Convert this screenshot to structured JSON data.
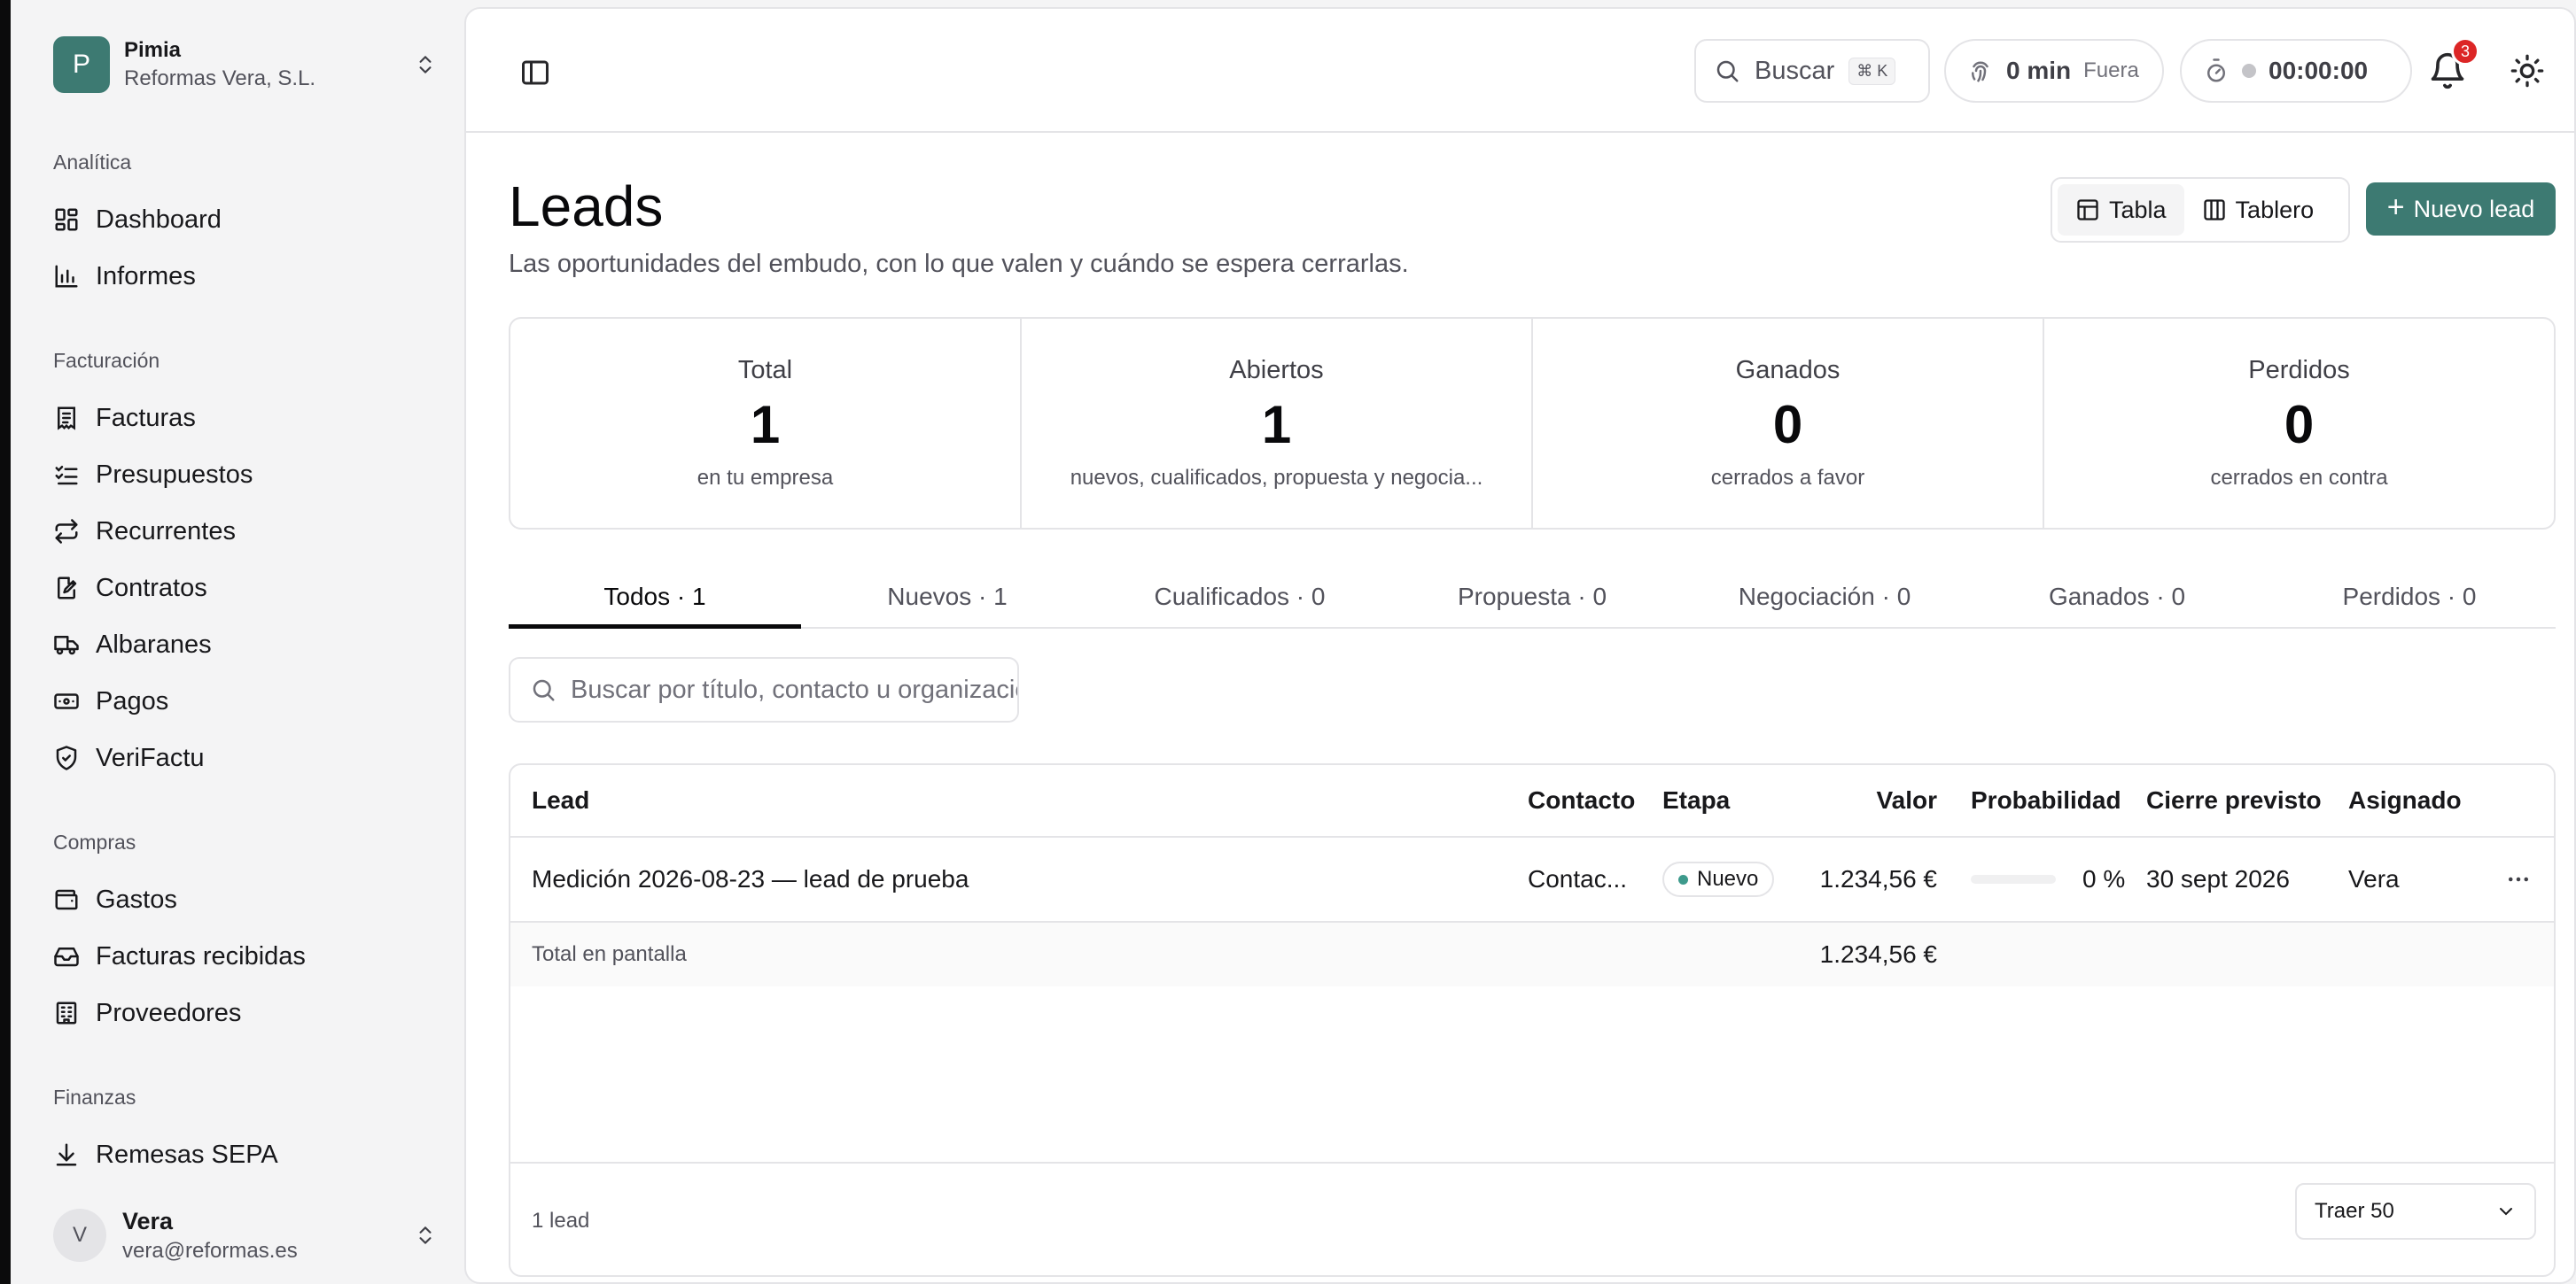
{
  "org": {
    "initial": "P",
    "name": "Pimia",
    "company": "Reformas Vera, S.L."
  },
  "sidebar": {
    "groups": [
      {
        "title": "Analítica",
        "items": [
          {
            "label": "Dashboard",
            "icon": "dashboard-icon"
          },
          {
            "label": "Informes",
            "icon": "bar-chart-icon"
          }
        ]
      },
      {
        "title": "Facturación",
        "items": [
          {
            "label": "Facturas",
            "icon": "invoice-icon"
          },
          {
            "label": "Presupuestos",
            "icon": "checklist-icon"
          },
          {
            "label": "Recurrentes",
            "icon": "repeat-icon"
          },
          {
            "label": "Contratos",
            "icon": "contract-edit-icon"
          },
          {
            "label": "Albaranes",
            "icon": "truck-icon"
          },
          {
            "label": "Pagos",
            "icon": "banknote-icon"
          },
          {
            "label": "VeriFactu",
            "icon": "shield-check-icon"
          }
        ]
      },
      {
        "title": "Compras",
        "items": [
          {
            "label": "Gastos",
            "icon": "wallet-icon"
          },
          {
            "label": "Facturas recibidas",
            "icon": "inbox-icon"
          },
          {
            "label": "Proveedores",
            "icon": "building-icon"
          }
        ]
      },
      {
        "title": "Finanzas",
        "items": [
          {
            "label": "Remesas SEPA",
            "icon": "download-icon"
          }
        ]
      }
    ]
  },
  "user": {
    "initial": "V",
    "name": "Vera",
    "email": "vera@reformas.es"
  },
  "topbar": {
    "search_label": "Buscar",
    "search_shortcut": "⌘ K",
    "clock_value": "0 min",
    "clock_status": "Fuera",
    "timer_value": "00:00:00",
    "notifications_count": "3"
  },
  "page": {
    "title": "Leads",
    "subtitle": "Las oportunidades del embudo, con lo que valen y cuándo se espera cerrarlas.",
    "view_table": "Tabla",
    "view_board": "Tablero",
    "new_lead": "Nuevo lead"
  },
  "stats": [
    {
      "label": "Total",
      "value": "1",
      "sub": "en tu empresa"
    },
    {
      "label": "Abiertos",
      "value": "1",
      "sub": "nuevos, cualificados, propuesta y negocia..."
    },
    {
      "label": "Ganados",
      "value": "0",
      "sub": "cerrados a favor"
    },
    {
      "label": "Perdidos",
      "value": "0",
      "sub": "cerrados en contra"
    }
  ],
  "tabs": [
    {
      "label": "Todos · 1",
      "active": true
    },
    {
      "label": "Nuevos · 1",
      "active": false
    },
    {
      "label": "Cualificados · 0",
      "active": false
    },
    {
      "label": "Propuesta · 0",
      "active": false
    },
    {
      "label": "Negociación · 0",
      "active": false
    },
    {
      "label": "Ganados · 0",
      "active": false
    },
    {
      "label": "Perdidos · 0",
      "active": false
    }
  ],
  "filter": {
    "placeholder": "Buscar por título, contacto u organización"
  },
  "table": {
    "headers": {
      "lead": "Lead",
      "contact": "Contacto",
      "stage": "Etapa",
      "value": "Valor",
      "probability": "Probabilidad",
      "close": "Cierre previsto",
      "assigned": "Asignado"
    },
    "rows": [
      {
        "lead": "Medición 2026-08-23 — lead de prueba",
        "contact": "Contac...",
        "stage": "Nuevo",
        "value": "1.234,56 €",
        "probability": "0 %",
        "probability_fraction": 0,
        "close": "30 sept 2026",
        "assigned": "Vera"
      }
    ],
    "footer": {
      "label": "Total en pantalla",
      "value": "1.234,56 €"
    },
    "row_count": "1 lead",
    "page_size": "Traer 50"
  },
  "colors": {
    "brand": "#3d7a72",
    "badge_danger": "#dc2626",
    "stage_new_dot": "#3d9a8c"
  }
}
